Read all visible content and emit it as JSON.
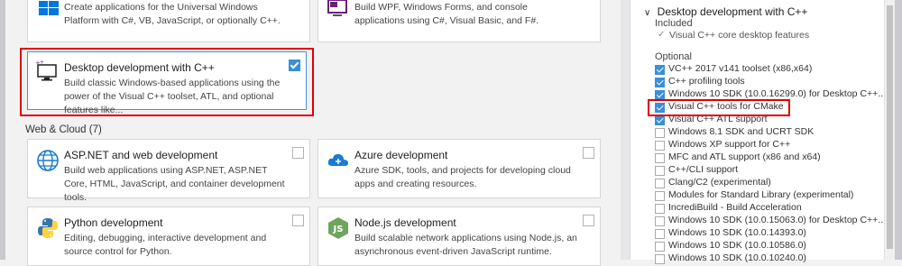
{
  "workloads": {
    "uwp": {
      "desc": "Create applications for the Universal Windows Platform with C#, VB, JavaScript, or optionally C++."
    },
    "desktop_net": {
      "desc": "Build WPF, Windows Forms, and console applications using C#, Visual Basic, and F#."
    },
    "desktop_cpp": {
      "title": "Desktop development with C++",
      "desc": "Build classic Windows-based applications using the power of the Visual C++ toolset, ATL, and optional features like..."
    },
    "web_cloud_label": "Web & Cloud (7)",
    "aspnet": {
      "title": "ASP.NET and web development",
      "desc": "Build web applications using ASP.NET, ASP.NET Core, HTML, JavaScript, and container development tools."
    },
    "azure": {
      "title": "Azure development",
      "desc": "Azure SDK, tools, and projects for developing cloud apps and creating resources."
    },
    "python": {
      "title": "Python development",
      "desc": "Editing, debugging, interactive development and source control for Python."
    },
    "nodejs": {
      "title": "Node.js development",
      "desc": "Build scalable network applications using Node.js, an asynchronous event-driven JavaScript runtime."
    }
  },
  "details": {
    "header": "Desktop development with C++",
    "included_label": "Included",
    "included_items": [
      "Visual C++ core desktop features"
    ],
    "optional_label": "Optional",
    "optional_items": [
      {
        "label": "VC++ 2017 v141 toolset (x86,x64)",
        "checked": true
      },
      {
        "label": "C++ profiling tools",
        "checked": true
      },
      {
        "label": "Windows 10 SDK (10.0.16299.0) for Desktop C++...",
        "checked": true
      },
      {
        "label": "Visual C++ tools for CMake",
        "checked": true
      },
      {
        "label": "Visual C++ ATL support",
        "checked": true
      },
      {
        "label": "Windows 8.1 SDK and UCRT SDK",
        "checked": false
      },
      {
        "label": "Windows XP support for C++",
        "checked": false
      },
      {
        "label": "MFC and ATL support (x86 and x64)",
        "checked": false
      },
      {
        "label": "C++/CLI support",
        "checked": false
      },
      {
        "label": "Clang/C2 (experimental)",
        "checked": false
      },
      {
        "label": "Modules for Standard Library (experimental)",
        "checked": false
      },
      {
        "label": "IncrediBuild - Build Acceleration",
        "checked": false
      },
      {
        "label": "Windows 10 SDK (10.0.15063.0) for Desktop C++...",
        "checked": false
      },
      {
        "label": "Windows 10 SDK (10.0.14393.0)",
        "checked": false
      },
      {
        "label": "Windows 10 SDK (10.0.10586.0)",
        "checked": false
      },
      {
        "label": "Windows 10 SDK (10.0.10240.0)",
        "checked": false
      }
    ]
  },
  "colors": {
    "accent": "#3b8ed8",
    "highlight": "#e00000"
  }
}
